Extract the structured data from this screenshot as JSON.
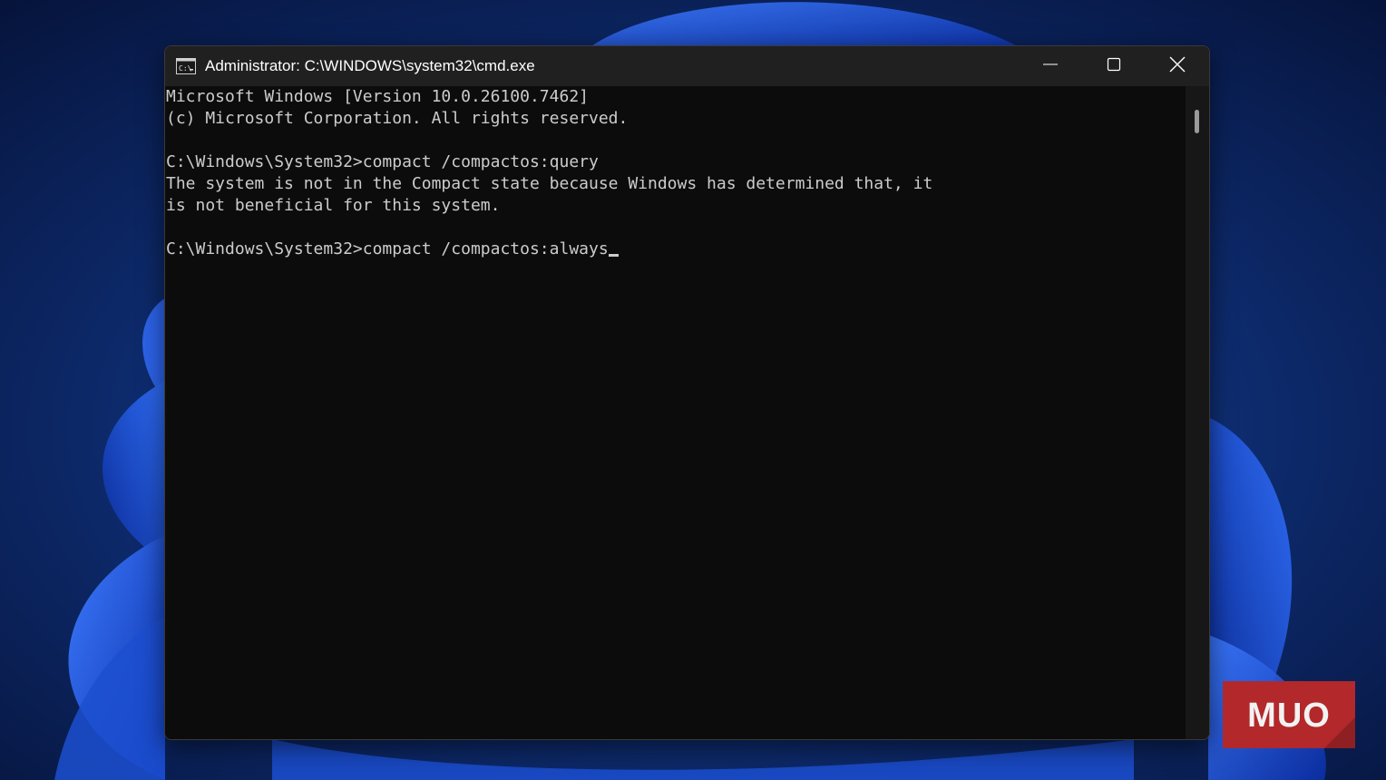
{
  "window": {
    "title": "Administrator: C:\\WINDOWS\\system32\\cmd.exe",
    "app_icon": "cmd-icon",
    "controls": [
      "minimize-icon",
      "maximize-icon",
      "close-icon"
    ]
  },
  "console": {
    "lines": [
      "Microsoft Windows [Version 10.0.26100.7462]",
      "(c) Microsoft Corporation. All rights reserved.",
      "",
      "C:\\Windows\\System32>compact /compactos:query",
      "The system is not in the Compact state because Windows has determined that, it",
      "is not beneficial for this system.",
      "",
      "C:\\Windows\\System32>compact /compactos:always"
    ]
  },
  "watermark": {
    "text": "MUO",
    "color": "#b3282b"
  },
  "colors": {
    "console_bg": "#0c0c0c",
    "console_text": "#cccccc",
    "titlebar_bg": "#202020"
  }
}
